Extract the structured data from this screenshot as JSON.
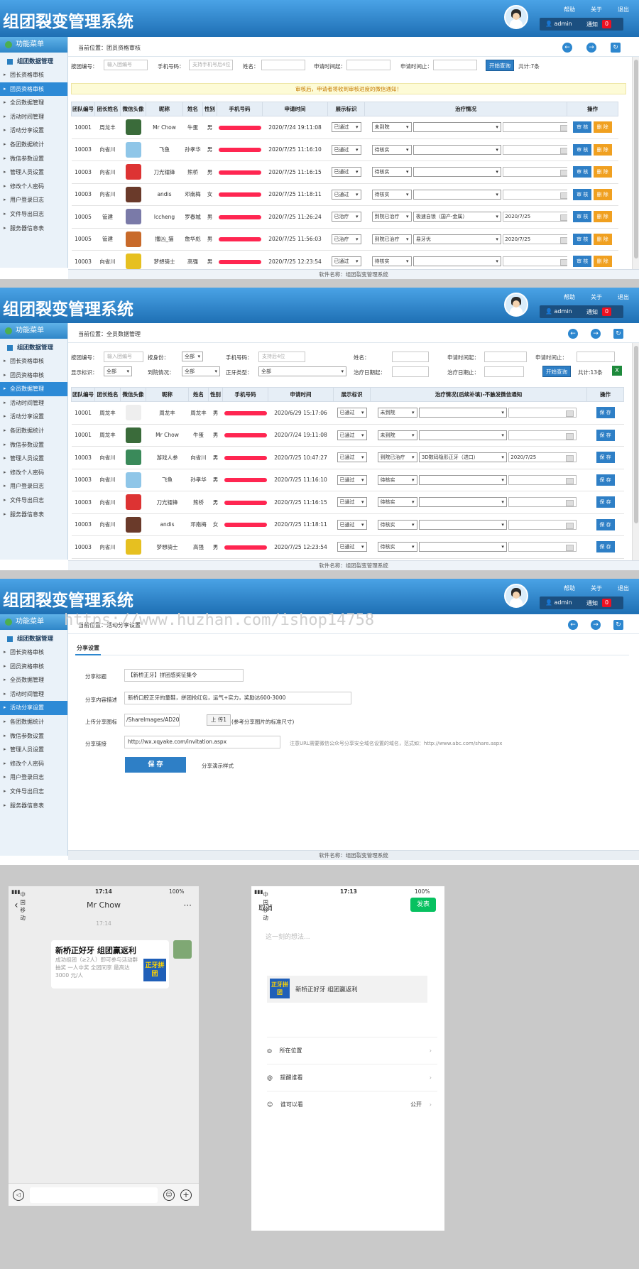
{
  "app_title": "组团裂变管理系统",
  "top_links": [
    "帮助",
    "关于",
    "退出"
  ],
  "user": {
    "name": "admin",
    "notify": "通知",
    "count": "0"
  },
  "menu_header": "功能菜单",
  "menu_group": "组团数据管理",
  "crumb_prefix": "当前位置：",
  "footer": "软件名称：组团裂变管理系统",
  "s1": {
    "crumb": "团员资格审核",
    "menu": [
      "团长资格审核",
      "团员资格审核",
      "全员数据管理",
      "活动时间管理",
      "活动分享设置",
      "各团数据统计",
      "微信参数设置",
      "管理人员设置",
      "修改个人密码",
      "用户登录日志",
      "文件导出日志",
      "服务器信息表"
    ],
    "filters": {
      "team_label": "按团编号：",
      "team_ph": "输入团编号",
      "phone_label": "手机号码：",
      "phone_ph": "支持手机号后4位",
      "name_label": "姓名：",
      "start_label": "申请时间起：",
      "end_label": "申请时间止：",
      "query": "开始查询",
      "total": "共计:7条"
    },
    "notice": "审核后，申请者将收到审核进度的微信通知！",
    "headers": [
      "团队编号",
      "团长姓名",
      "微信头像",
      "昵称",
      "姓名",
      "性别",
      "手机号码",
      "申请时间",
      "展示标识",
      "治疗情况",
      "操作"
    ],
    "rows": [
      {
        "team": "10001",
        "leader": "周龙丰",
        "avatar": "#3a6b3a",
        "nick": "Mr Chow",
        "name": "牛蛋",
        "sex": "男",
        "time": "2020/7/24 19:11:08",
        "show": "已通过",
        "treat": "未到院",
        "plan": "",
        "date": ""
      },
      {
        "team": "10003",
        "leader": "向省川",
        "avatar": "#8fc6e8",
        "nick": "飞鱼",
        "name": "孙孝华",
        "sex": "男",
        "time": "2020/7/25 11:16:10",
        "show": "已通过",
        "treat": "待核实",
        "plan": "",
        "date": ""
      },
      {
        "team": "10003",
        "leader": "向省川",
        "avatar": "#d33",
        "nick": "刀光镭锋",
        "name": "熊桥",
        "sex": "男",
        "time": "2020/7/25 11:16:15",
        "show": "已通过",
        "treat": "待核实",
        "plan": "",
        "date": ""
      },
      {
        "team": "10003",
        "leader": "向省川",
        "avatar": "#6a3a2a",
        "nick": "andis",
        "name": "邓南梅",
        "sex": "女",
        "time": "2020/7/25 11:18:11",
        "show": "已通过",
        "treat": "待核实",
        "plan": "",
        "date": ""
      },
      {
        "team": "10005",
        "leader": "管建",
        "avatar": "#7a7aa8",
        "nick": "lccheng",
        "name": "罗春城",
        "sex": "男",
        "time": "2020/7/25 11:26:24",
        "show": "已治疗",
        "treat": "到院已治疗",
        "plan": "极速自锁（国产-金属）",
        "date": "2020/7/25"
      },
      {
        "team": "10005",
        "leader": "管建",
        "avatar": "#c86a2a",
        "nick": "攫凶_猫",
        "name": "詹华彪",
        "sex": "男",
        "time": "2020/7/25 11:56:03",
        "show": "已治疗",
        "treat": "到院已治疗",
        "plan": "易牙优",
        "date": "2020/7/25"
      },
      {
        "team": "10003",
        "leader": "向省川",
        "avatar": "#e6c020",
        "nick": "梦想骑士",
        "name": "高强",
        "sex": "男",
        "time": "2020/7/25 12:23:54",
        "show": "已通过",
        "treat": "待核实",
        "plan": "",
        "date": ""
      }
    ],
    "btn_review": "审 核",
    "btn_delete": "删 除"
  },
  "s2": {
    "crumb": "全员数据管理",
    "menu": [
      "团长资格审核",
      "团员资格审核",
      "全员数据管理",
      "活动时间管理",
      "活动分享设置",
      "各团数据统计",
      "微信参数设置",
      "管理人员设置",
      "修改个人密码",
      "用户登录日志",
      "文件导出日志",
      "服务器信息表"
    ],
    "filters": {
      "team_label": "按团编号：",
      "team_ph": "输入团编号",
      "state_label": "按身份：",
      "state_val": "全部",
      "phone_label": "手机号码：",
      "phone_ph": "支持后4位",
      "name_label": "姓名：",
      "start_label": "申请时间起：",
      "end_label": "申请时间止：",
      "show_label": "显示标识：",
      "show_val": "全部",
      "arrive_label": "到院情况：",
      "arrive_val": "全部",
      "plan_label": "正牙类型：",
      "plan_val": "全部",
      "tstart_label": "治疗日期起：",
      "tend_label": "治疗日期止：",
      "query": "开始查询",
      "total": "共计:13条"
    },
    "headers": [
      "团队编号",
      "团长姓名",
      "微信头像",
      "昵称",
      "姓名",
      "性别",
      "手机号码",
      "申请时间",
      "展示标识",
      "治疗情况(后续补填)-不触发微信通知",
      "操作"
    ],
    "rows": [
      {
        "team": "10001",
        "leader": "周龙丰",
        "avatar": "#eee",
        "nick": "周龙丰",
        "name": "周龙丰",
        "sex": "男",
        "time": "2020/6/29 15:17:06",
        "show": "已通过",
        "treat": "未到院",
        "plan": "",
        "date": ""
      },
      {
        "team": "10001",
        "leader": "周龙丰",
        "avatar": "#3a6b3a",
        "nick": "Mr Chow",
        "name": "牛蛋",
        "sex": "男",
        "time": "2020/7/24 19:11:08",
        "show": "已通过",
        "treat": "未到院",
        "plan": "",
        "date": ""
      },
      {
        "team": "10003",
        "leader": "向省川",
        "avatar": "#3a8a5a",
        "nick": "游戏人参",
        "name": "向省川",
        "sex": "男",
        "time": "2020/7/25 10:47:27",
        "show": "已通过",
        "treat": "到院已治疗",
        "plan": "3D数码隐形正牙（进口）",
        "date": "2020/7/25"
      },
      {
        "team": "10003",
        "leader": "向省川",
        "avatar": "#8fc6e8",
        "nick": "飞鱼",
        "name": "孙孝华",
        "sex": "男",
        "time": "2020/7/25 11:16:10",
        "show": "已通过",
        "treat": "待核实",
        "plan": "",
        "date": ""
      },
      {
        "team": "10003",
        "leader": "向省川",
        "avatar": "#d33",
        "nick": "刀光镭锋",
        "name": "熊桥",
        "sex": "男",
        "time": "2020/7/25 11:16:15",
        "show": "已通过",
        "treat": "待核实",
        "plan": "",
        "date": ""
      },
      {
        "team": "10003",
        "leader": "向省川",
        "avatar": "#6a3a2a",
        "nick": "andis",
        "name": "邓南梅",
        "sex": "女",
        "time": "2020/7/25 11:18:11",
        "show": "已通过",
        "treat": "待核实",
        "plan": "",
        "date": ""
      },
      {
        "team": "10003",
        "leader": "向省川",
        "avatar": "#e6c020",
        "nick": "梦想骑士",
        "name": "高强",
        "sex": "男",
        "time": "2020/7/25 12:23:54",
        "show": "已通过",
        "treat": "待核实",
        "plan": "",
        "date": ""
      }
    ],
    "btn_save": "保 存"
  },
  "s3": {
    "crumb": "活动分享设置",
    "menu": [
      "团长资格审核",
      "团员资格审核",
      "全员数据管理",
      "活动时间管理",
      "活动分享设置",
      "各团数据统计",
      "微信参数设置",
      "管理人员设置",
      "修改个人密码",
      "用户登录日志",
      "文件导出日志",
      "服务器信息表"
    ],
    "tab": "分享设置",
    "title_label": "分享标题",
    "title_val": "【新桥正牙】拼团感奖征集令",
    "desc_label": "分享内容描述",
    "desc_val": "新桥口腔正牙的童鞋，拼团抢红包，运气+实力，奖励达600-3000",
    "icon_label": "上传分享图标",
    "icon_val": "/ShareImages/AD2020072409",
    "upload": "上 传1",
    "icon_hint": "(参考分享图片的标准尺寸)",
    "link_label": "分享链接",
    "link_val": "http://wx.xqyake.com/invitation.aspx",
    "link_hint": "注意URL需要微信公众号分享安全域名设置的域名，范式如：http://www.abc.com/share.aspx",
    "save": "保 存",
    "demo": "分享演示样式",
    "watermark": "https://www.huzhan.com/ishop14758"
  },
  "phone1": {
    "carrier": "中国移动",
    "time": "17:14",
    "battery": "100%",
    "contact": "Mr Chow",
    "msg_time": "17:14",
    "card_title": "新桥正好牙 组团赢返利",
    "card_desc": "成功组团（≥2人）即可参与活动群抽奖 一人中奖 全团同享 最高达 3000 元/人",
    "logo": "正牙拼团"
  },
  "phone2": {
    "carrier": "中国移动",
    "time": "17:13",
    "battery": "100%",
    "cancel": "取消",
    "publish": "发表",
    "placeholder": "这一刻的想法...",
    "link_text": "新桥正好牙 组团赢返利",
    "logo": "正牙拼团",
    "loc": "所在位置",
    "remind": "提醒谁看",
    "who": "谁可以看",
    "who_val": "公开"
  }
}
